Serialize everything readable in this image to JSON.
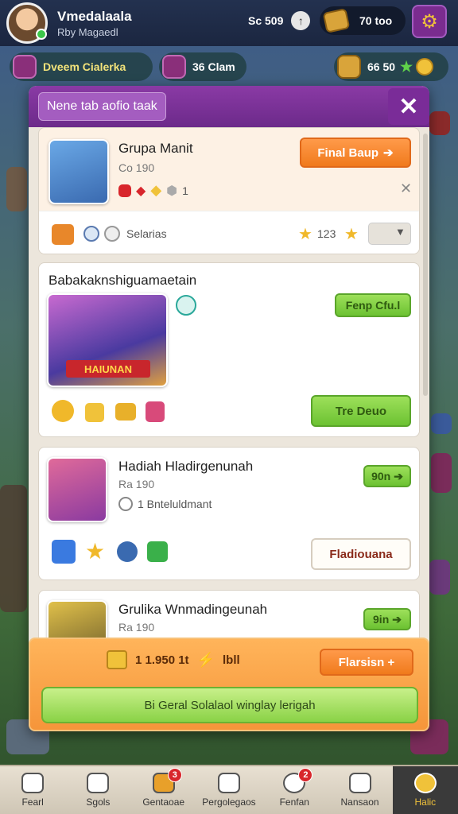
{
  "hud": {
    "player_name": "Vmedalaala",
    "player_sub": "Rby Magaedl",
    "stat": "Sc 509",
    "gold": "70 too"
  },
  "resources": {
    "event_label": "Dveem Cialerka",
    "event_timer": "36 Clam",
    "coins": "66 50"
  },
  "modal": {
    "title": "Nene tab aofio taak",
    "close_label": "✕",
    "cards": [
      {
        "title": "Grupa Manit",
        "subtitle": "Co 190",
        "button": "Final Baup",
        "count": "1",
        "footer_label": "Selarias",
        "footer_value": "123"
      },
      {
        "title": "Babakaknshiguamaetain",
        "tag_button": "Fenp Cfu.l",
        "banner": "HAIUNAN",
        "action_button": "Tre Deuo"
      },
      {
        "title": "Hadiah Hladirgenunah",
        "subtitle": "Ra 190",
        "tag_button": "90n",
        "detail": "1 Bnteluldmant",
        "action_button": "Fladiouana"
      },
      {
        "title": "Grulika Wnmadingeunah",
        "subtitle": "Ra 190",
        "tag_button": "9in"
      }
    ]
  },
  "summary": {
    "amount": "1 1.950 1t",
    "extra": "lbll",
    "button": "Flarsisn +",
    "claim": "Bi Geral Solalaol winglay lerigah"
  },
  "nav": [
    {
      "label": "Fearl",
      "badge": ""
    },
    {
      "label": "Sgols",
      "badge": ""
    },
    {
      "label": "Gentaoae",
      "badge": "3"
    },
    {
      "label": "Pergolegaos",
      "badge": ""
    },
    {
      "label": "Fenfan",
      "badge": "2"
    },
    {
      "label": "Nansaon",
      "badge": ""
    },
    {
      "label": "Halic",
      "badge": ""
    }
  ],
  "colors": {
    "modal_header": "#7a2c98",
    "accent_orange": "#f07a1c",
    "accent_green": "#6cc232"
  }
}
